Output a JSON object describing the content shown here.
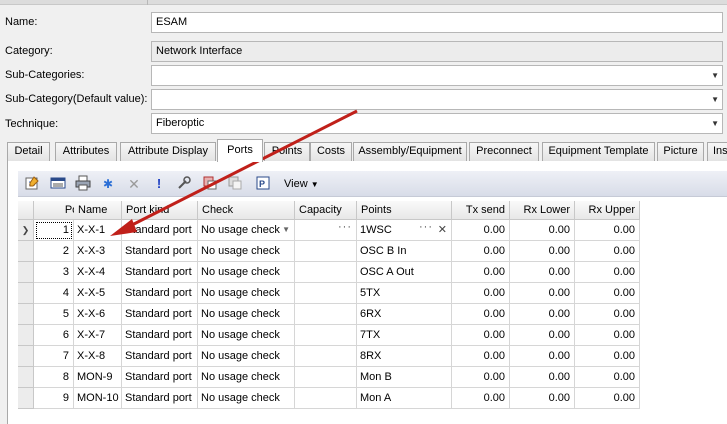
{
  "form": {
    "name_label": "Name:",
    "name_value": "ESAM",
    "category_label": "Category:",
    "category_value": "Network Interface",
    "subcategories_label": "Sub-Categories:",
    "subcategories_value": "",
    "subcategory_default_label": "Sub-Category(Default value):",
    "subcategory_default_value": "",
    "technique_label": "Technique:",
    "technique_value": "Fiberoptic"
  },
  "tabs": [
    "Detail",
    "Attributes",
    "Attribute Display",
    "Ports",
    "Points",
    "Costs",
    "Assembly/Equipment",
    "Preconnect",
    "Equipment Template",
    "Picture",
    "Ins"
  ],
  "active_tab": "Ports",
  "toolbar": {
    "icons": [
      "edit-icon",
      "list-icon",
      "print-icon",
      "snowflake-icon",
      "delete-icon",
      "exclamation-icon",
      "wrench-icon",
      "link-icon",
      "unlink-icon",
      "properties-icon"
    ],
    "view_label": "View"
  },
  "grid": {
    "columns": [
      "Port",
      "Name",
      "Port kind",
      "Check",
      "Capacity",
      "Points",
      "Tx send",
      "Rx Lower",
      "Rx Upper"
    ],
    "rows": [
      {
        "port": "1",
        "name": "X-X-1",
        "kind": "Standard port",
        "check": "No usage check",
        "capacity": "",
        "points": "1WSC",
        "tx": "0.00",
        "rxl": "0.00",
        "rxu": "0.00"
      },
      {
        "port": "2",
        "name": "X-X-3",
        "kind": "Standard port",
        "check": "No usage check",
        "capacity": "",
        "points": "OSC B In",
        "tx": "0.00",
        "rxl": "0.00",
        "rxu": "0.00"
      },
      {
        "port": "3",
        "name": "X-X-4",
        "kind": "Standard port",
        "check": "No usage check",
        "capacity": "",
        "points": "OSC A Out",
        "tx": "0.00",
        "rxl": "0.00",
        "rxu": "0.00"
      },
      {
        "port": "4",
        "name": "X-X-5",
        "kind": "Standard port",
        "check": "No usage check",
        "capacity": "",
        "points": "5TX",
        "tx": "0.00",
        "rxl": "0.00",
        "rxu": "0.00"
      },
      {
        "port": "5",
        "name": "X-X-6",
        "kind": "Standard port",
        "check": "No usage check",
        "capacity": "",
        "points": "6RX",
        "tx": "0.00",
        "rxl": "0.00",
        "rxu": "0.00"
      },
      {
        "port": "6",
        "name": "X-X-7",
        "kind": "Standard port",
        "check": "No usage check",
        "capacity": "",
        "points": "7TX",
        "tx": "0.00",
        "rxl": "0.00",
        "rxu": "0.00"
      },
      {
        "port": "7",
        "name": "X-X-8",
        "kind": "Standard port",
        "check": "No usage check",
        "capacity": "",
        "points": "8RX",
        "tx": "0.00",
        "rxl": "0.00",
        "rxu": "0.00"
      },
      {
        "port": "8",
        "name": "MON-9",
        "kind": "Standard port",
        "check": "No usage check",
        "capacity": "",
        "points": "Mon B",
        "tx": "0.00",
        "rxl": "0.00",
        "rxu": "0.00"
      },
      {
        "port": "9",
        "name": "MON-10",
        "kind": "Standard port",
        "check": "No usage check",
        "capacity": "",
        "points": "Mon A",
        "tx": "0.00",
        "rxl": "0.00",
        "rxu": "0.00"
      }
    ]
  },
  "colors": {
    "annotation_arrow": "#c0201a"
  }
}
